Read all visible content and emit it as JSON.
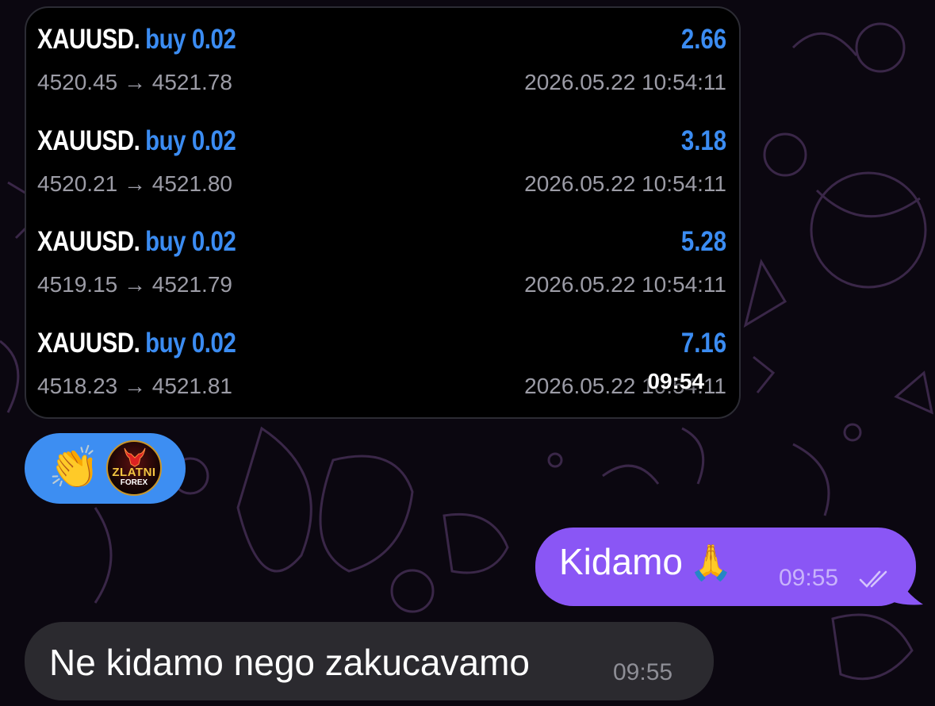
{
  "trades": [
    {
      "symbol": "XAUUSD.",
      "side": "buy 0.02",
      "profit": "2.66",
      "prices": "4520.45 → 4521.78",
      "datetime": "2026.05.22 10:54:11"
    },
    {
      "symbol": "XAUUSD.",
      "side": "buy 0.02",
      "profit": "3.18",
      "prices": "4520.21 → 4521.80",
      "datetime": "2026.05.22 10:54:11"
    },
    {
      "symbol": "XAUUSD.",
      "side": "buy 0.02",
      "profit": "5.28",
      "prices": "4519.15 → 4521.79",
      "datetime": "2026.05.22 10:54:11"
    },
    {
      "symbol": "XAUUSD.",
      "side": "buy 0.02",
      "profit": "7.16",
      "prices": "4518.23 → 4521.81",
      "datetime": "2026.05.22 10:54:11"
    }
  ],
  "card_time": "09:54",
  "reaction": {
    "emoji": "👏",
    "avatar_brand_top": "ZLATNI",
    "avatar_brand_bottom": "FOREX"
  },
  "outgoing": {
    "text": "Kidamo",
    "emoji": "🙏",
    "time": "09:55",
    "status_icon": "double-check-icon"
  },
  "incoming": {
    "text": "Ne kidamo nego zakucavamo",
    "time": "09:55"
  },
  "colors": {
    "accent_blue": "#3b8cf2",
    "outgoing_bubble": "#8a56f5",
    "incoming_bubble": "#2b2a2f",
    "background": "#0b0710"
  }
}
